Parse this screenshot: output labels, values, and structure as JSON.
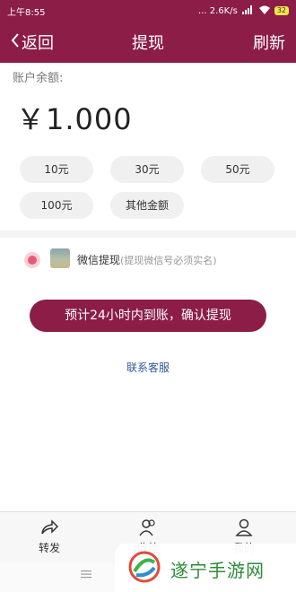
{
  "status": {
    "time": "上午8:55",
    "network": "... 2.6K/s",
    "battery": "32"
  },
  "nav": {
    "back_label": "返回",
    "title": "提现",
    "refresh_label": "刷新"
  },
  "balance": {
    "label": "账户余额:",
    "amount": "￥1.000"
  },
  "chips": [
    "10元",
    "30元",
    "50元",
    "100元",
    "其他金额"
  ],
  "wechat": {
    "label": "微信提现",
    "note": "(提现微信号必须实名)"
  },
  "confirm_label": "预计24小时内到账，确认提现",
  "contact_label": "联系客服",
  "tabs": [
    "转发",
    "收徒",
    "我的"
  ],
  "watermark": {
    "text": "遂宁手游网"
  },
  "colors": {
    "brand": "#8b1d46",
    "link": "#2d5b9c",
    "radio": "#e45c74",
    "watermark": "#2c8b3a"
  }
}
